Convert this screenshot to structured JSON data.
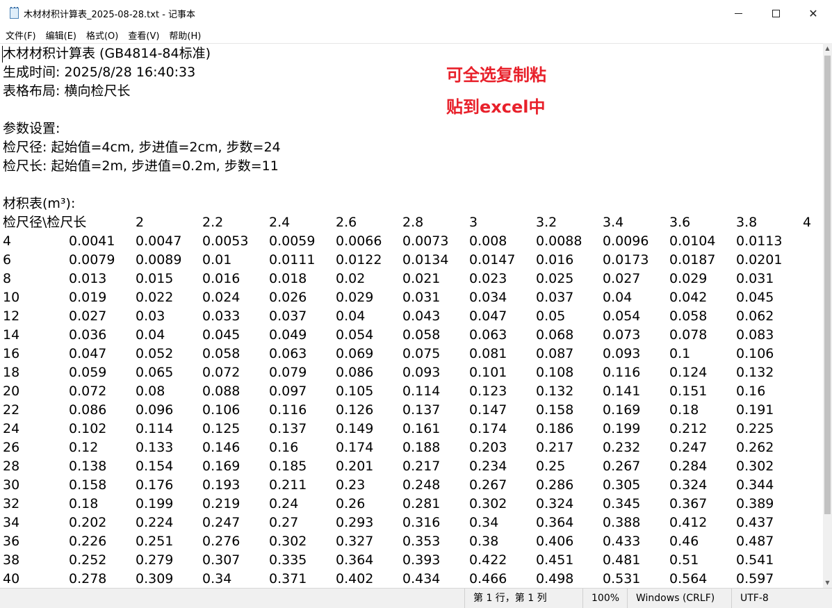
{
  "window": {
    "title": "木材材积计算表_2025-08-28.txt - 记事本",
    "minimize": "─",
    "maximize": "☐",
    "close": "✕"
  },
  "menu": [
    {
      "label": "文件(F)",
      "name": "menu-file"
    },
    {
      "label": "编辑(E)",
      "name": "menu-edit"
    },
    {
      "label": "格式(O)",
      "name": "menu-format"
    },
    {
      "label": "查看(V)",
      "name": "menu-view"
    },
    {
      "label": "帮助(H)",
      "name": "menu-help"
    }
  ],
  "document": {
    "header_lines": [
      "木材材积计算表 (GB4814-84标准)",
      "生成时间: 2025/8/28 16:40:33",
      "表格布局: 横向检尺长",
      "",
      "参数设置:",
      "检尺径: 起始值=4cm, 步进值=2cm, 步数=24",
      "检尺长: 起始值=2m, 步进值=0.2m, 步数=11",
      "",
      "材积表(m³):"
    ],
    "table_header": [
      "检尺径\\检尺长",
      "2",
      "2.2",
      "2.4",
      "2.6",
      "2.8",
      "3",
      "3.2",
      "3.4",
      "3.6",
      "3.8",
      "4"
    ],
    "table_rows": [
      [
        "4",
        "0.0041",
        "0.0047",
        "0.0053",
        "0.0059",
        "0.0066",
        "0.0073",
        "0.008",
        "0.0088",
        "0.0096",
        "0.0104",
        "0.0113"
      ],
      [
        "6",
        "0.0079",
        "0.0089",
        "0.01",
        "0.0111",
        "0.0122",
        "0.0134",
        "0.0147",
        "0.016",
        "0.0173",
        "0.0187",
        "0.0201"
      ],
      [
        "8",
        "0.013",
        "0.015",
        "0.016",
        "0.018",
        "0.02",
        "0.021",
        "0.023",
        "0.025",
        "0.027",
        "0.029",
        "0.031"
      ],
      [
        "10",
        "0.019",
        "0.022",
        "0.024",
        "0.026",
        "0.029",
        "0.031",
        "0.034",
        "0.037",
        "0.04",
        "0.042",
        "0.045"
      ],
      [
        "12",
        "0.027",
        "0.03",
        "0.033",
        "0.037",
        "0.04",
        "0.043",
        "0.047",
        "0.05",
        "0.054",
        "0.058",
        "0.062"
      ],
      [
        "14",
        "0.036",
        "0.04",
        "0.045",
        "0.049",
        "0.054",
        "0.058",
        "0.063",
        "0.068",
        "0.073",
        "0.078",
        "0.083"
      ],
      [
        "16",
        "0.047",
        "0.052",
        "0.058",
        "0.063",
        "0.069",
        "0.075",
        "0.081",
        "0.087",
        "0.093",
        "0.1",
        "0.106"
      ],
      [
        "18",
        "0.059",
        "0.065",
        "0.072",
        "0.079",
        "0.086",
        "0.093",
        "0.101",
        "0.108",
        "0.116",
        "0.124",
        "0.132"
      ],
      [
        "20",
        "0.072",
        "0.08",
        "0.088",
        "0.097",
        "0.105",
        "0.114",
        "0.123",
        "0.132",
        "0.141",
        "0.151",
        "0.16"
      ],
      [
        "22",
        "0.086",
        "0.096",
        "0.106",
        "0.116",
        "0.126",
        "0.137",
        "0.147",
        "0.158",
        "0.169",
        "0.18",
        "0.191"
      ],
      [
        "24",
        "0.102",
        "0.114",
        "0.125",
        "0.137",
        "0.149",
        "0.161",
        "0.174",
        "0.186",
        "0.199",
        "0.212",
        "0.225"
      ],
      [
        "26",
        "0.12",
        "0.133",
        "0.146",
        "0.16",
        "0.174",
        "0.188",
        "0.203",
        "0.217",
        "0.232",
        "0.247",
        "0.262"
      ],
      [
        "28",
        "0.138",
        "0.154",
        "0.169",
        "0.185",
        "0.201",
        "0.217",
        "0.234",
        "0.25",
        "0.267",
        "0.284",
        "0.302"
      ],
      [
        "30",
        "0.158",
        "0.176",
        "0.193",
        "0.211",
        "0.23",
        "0.248",
        "0.267",
        "0.286",
        "0.305",
        "0.324",
        "0.344"
      ],
      [
        "32",
        "0.18",
        "0.199",
        "0.219",
        "0.24",
        "0.26",
        "0.281",
        "0.302",
        "0.324",
        "0.345",
        "0.367",
        "0.389"
      ],
      [
        "34",
        "0.202",
        "0.224",
        "0.247",
        "0.27",
        "0.293",
        "0.316",
        "0.34",
        "0.364",
        "0.388",
        "0.412",
        "0.437"
      ],
      [
        "36",
        "0.226",
        "0.251",
        "0.276",
        "0.302",
        "0.327",
        "0.353",
        "0.38",
        "0.406",
        "0.433",
        "0.46",
        "0.487"
      ],
      [
        "38",
        "0.252",
        "0.279",
        "0.307",
        "0.335",
        "0.364",
        "0.393",
        "0.422",
        "0.451",
        "0.481",
        "0.51",
        "0.541"
      ],
      [
        "40",
        "0.278",
        "0.309",
        "0.34",
        "0.371",
        "0.402",
        "0.434",
        "0.466",
        "0.498",
        "0.531",
        "0.564",
        "0.597"
      ]
    ]
  },
  "annotation": {
    "line1": "可全选复制粘",
    "line2": "贴到excel中",
    "color": "#e8202a"
  },
  "status": {
    "position": "第 1 行，第 1 列",
    "zoom": "100%",
    "line_ending": "Windows (CRLF)",
    "encoding": "UTF-8"
  }
}
